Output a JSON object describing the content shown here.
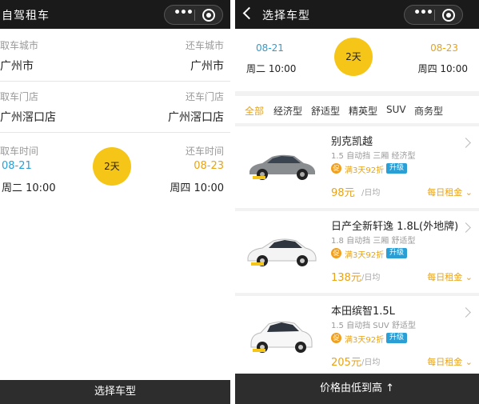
{
  "left": {
    "title": "自驾租车",
    "pickup_city_label": "取车城市",
    "pickup_city": "广州市",
    "return_city_label": "还车城市",
    "return_city": "广州市",
    "pickup_store_label": "取车门店",
    "pickup_store": "广州滘口店",
    "return_store_label": "还车门店",
    "return_store": "广州滘口店",
    "pickup_time_label": "取车时间",
    "pickup_date": "08-21",
    "pickup_weekday_time": "周二 10:00",
    "return_time_label": "还车时间",
    "return_date": "08-23",
    "return_weekday_time": "周四 10:00",
    "duration": "2天",
    "bottom_button": "选择车型"
  },
  "right": {
    "title": "选择车型",
    "pickup_date": "08-21",
    "pickup_weekday_time": "周二 10:00",
    "return_date": "08-23",
    "return_weekday_time": "周四 10:00",
    "duration": "2天",
    "filters": [
      "全部",
      "经济型",
      "舒适型",
      "精英型",
      "SUV",
      "商务型"
    ],
    "active_filter": "全部",
    "cars": [
      {
        "name": "别克凯越",
        "spec": "1.5 自动挡 三厢 经济型",
        "promo_icon": "促",
        "promo": "满3天92折",
        "tag": "升级",
        "price": "98元",
        "unit": "/日均",
        "detail": "每日租金"
      },
      {
        "name": "日产全新轩逸 1.8L(外地牌)",
        "spec": "1.8 自动挡 三厢 舒适型",
        "promo_icon": "促",
        "promo": "满3天92折",
        "tag": "升级",
        "price": "138元",
        "unit": "/日均",
        "detail": "每日租金"
      },
      {
        "name": "本田缤智1.5L",
        "spec": "1.5 自动挡 SUV 舒适型",
        "promo_icon": "促",
        "promo": "满3天92折",
        "tag": "升级",
        "price": "205元",
        "unit": "/日均",
        "detail": "每日租金"
      }
    ],
    "bottom_button": "价格由低到高 ↑"
  },
  "capsule": {
    "more": "•••"
  },
  "colors": {
    "accent_yellow": "#f5c518",
    "orange": "#e8a317",
    "blue": "#2a9fd6",
    "navbar": "#1a1a1a"
  },
  "icons": [
    "more-dots-icon",
    "close-circle-icon",
    "back-chevron-icon",
    "chevron-right-icon",
    "chevron-down-icon"
  ]
}
